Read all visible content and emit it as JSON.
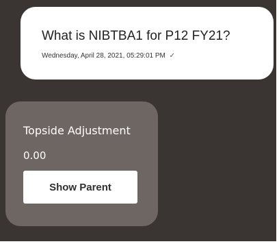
{
  "user_message": {
    "text": "What is NIBTBA1 for P12 FY21?",
    "timestamp": "Wednesday, April 28, 2021, 05:29:01 PM",
    "status_icon": "✓"
  },
  "bot_card": {
    "title": "Topside Adjustment",
    "value": "0.00",
    "button_label": "Show Parent"
  },
  "colors": {
    "chat_background": "#3a3532",
    "user_bubble": "#ffffff",
    "bot_card": "#6e6663"
  }
}
